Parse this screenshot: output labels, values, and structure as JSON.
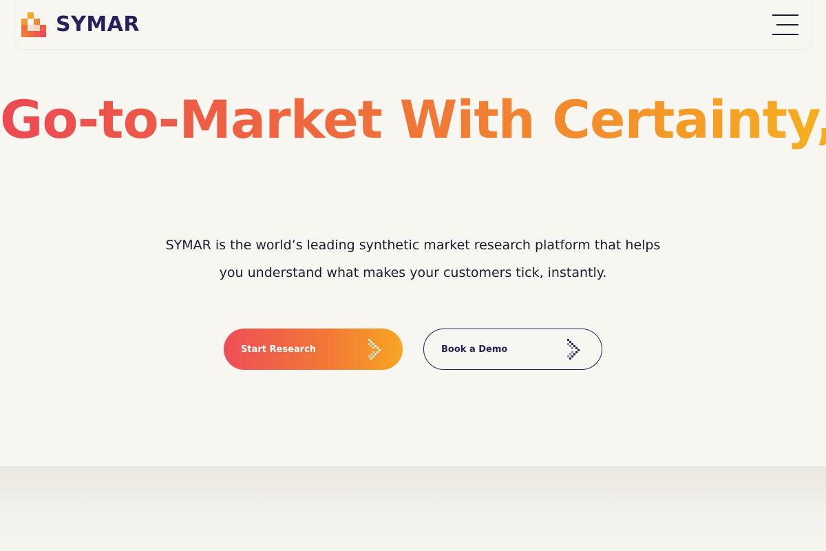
{
  "brand": {
    "name": "SYMAR"
  },
  "hero": {
    "headline": "Go-to-Market With Certainty,",
    "description": "SYMAR is the world’s leading synthetic market research platform that helps you understand what makes your customers tick, instantly."
  },
  "actions": {
    "primary_label": "Start Research",
    "secondary_label": "Book a Demo"
  },
  "icons": {
    "logo": "pixel-logo-icon",
    "menu": "hamburger-menu-icon",
    "arrow": "pixel-arrow-right-icon"
  },
  "colors": {
    "brand_navy": "#2a1f5c",
    "gradient_start": "#ec4a52",
    "gradient_end": "#f6ae20",
    "background": "#f8f6f1"
  }
}
